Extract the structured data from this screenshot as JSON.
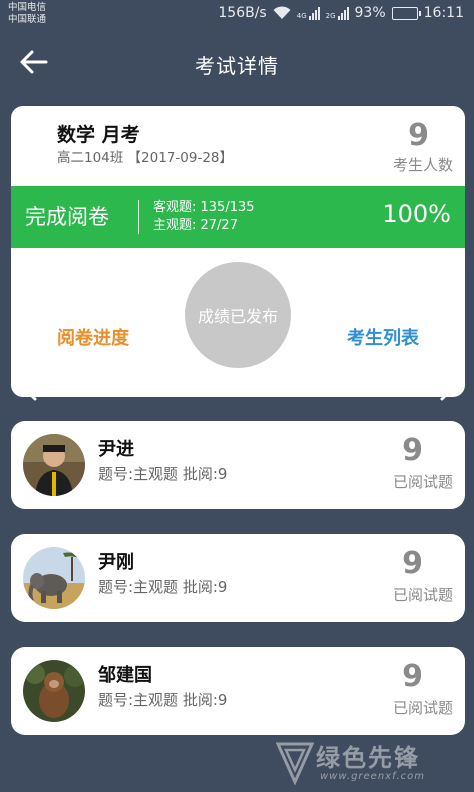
{
  "status_bar": {
    "carrier_1": "中国电信",
    "carrier_2": "中国联通",
    "speed": "156B/s",
    "net_1": "4G",
    "net_2": "2G",
    "battery": "93%",
    "battery_level": 0.93,
    "time": "16:11"
  },
  "header": {
    "back_icon": "arrow-left-icon",
    "title": "考试详情"
  },
  "exam": {
    "title": "数学 月考",
    "subtitle": "高二104班 【2017-09-28】",
    "student_count": "9",
    "student_count_label": "考生人数",
    "status": "完成阅卷",
    "objective": "客观题: 135/135",
    "subjective": "主观题: 27/27",
    "percent": "100%",
    "progress_link": "阅卷进度",
    "publish": "成绩已发布",
    "list_link": "考生列表"
  },
  "students": [
    {
      "name": "尹进",
      "info": "题号:主观题 批阅:9",
      "count": "9",
      "count_label": "已阅试题"
    },
    {
      "name": "尹刚",
      "info": "题号:主观题 批阅:9",
      "count": "9",
      "count_label": "已阅试题"
    },
    {
      "name": "邹建国",
      "info": "题号:主观题 批阅:9",
      "count": "9",
      "count_label": "已阅试题"
    }
  ],
  "watermark": {
    "text": "绿色先锋",
    "url": "www.greenxf.com"
  },
  "colors": {
    "background": "#3f4b5e",
    "accent_green": "#2db84d",
    "progress_orange": "#e8902e",
    "list_blue": "#2f8fd0"
  }
}
